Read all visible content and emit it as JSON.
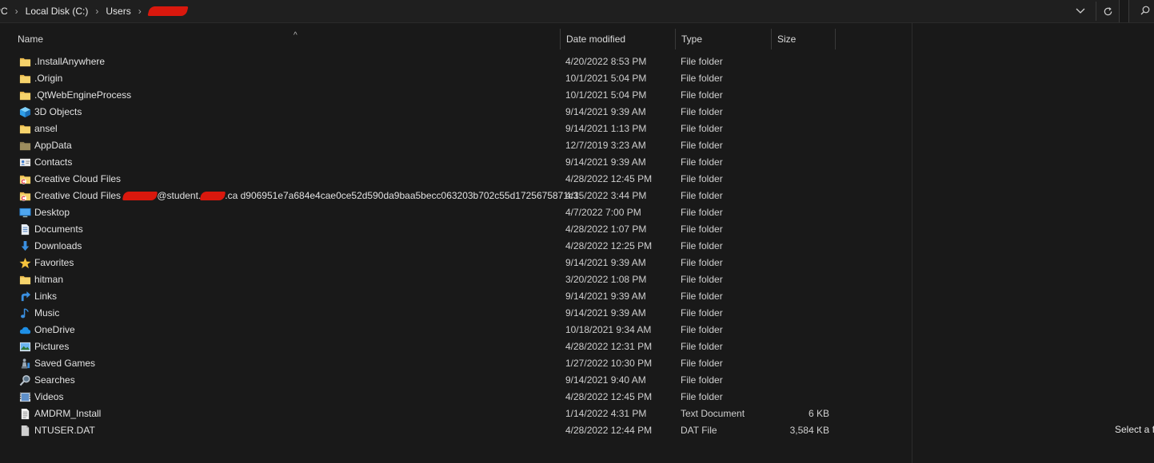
{
  "address": {
    "crumbs": [
      "PC",
      "Local Disk (C:)",
      "Users"
    ],
    "dropdown_icon": "chevron-down-icon",
    "refresh_icon": "refresh-icon",
    "search_icon": "search-icon"
  },
  "columns": {
    "name": "Name",
    "date": "Date modified",
    "type": "Type",
    "size": "Size"
  },
  "files": [
    {
      "name": ".InstallAnywhere",
      "date": "4/20/2022 8:53 PM",
      "type": "File folder",
      "size": "",
      "icon": "folder"
    },
    {
      "name": ".Origin",
      "date": "10/1/2021 5:04 PM",
      "type": "File folder",
      "size": "",
      "icon": "folder"
    },
    {
      "name": ".QtWebEngineProcess",
      "date": "10/1/2021 5:04 PM",
      "type": "File folder",
      "size": "",
      "icon": "folder"
    },
    {
      "name": "3D Objects",
      "date": "9/14/2021 9:39 AM",
      "type": "File folder",
      "size": "",
      "icon": "cube"
    },
    {
      "name": "ansel",
      "date": "9/14/2021 1:13 PM",
      "type": "File folder",
      "size": "",
      "icon": "folder"
    },
    {
      "name": "AppData",
      "date": "12/7/2019 3:23 AM",
      "type": "File folder",
      "size": "",
      "icon": "folder-hidden"
    },
    {
      "name": "Contacts",
      "date": "9/14/2021 9:39 AM",
      "type": "File folder",
      "size": "",
      "icon": "contacts"
    },
    {
      "name": "Creative Cloud Files",
      "date": "4/28/2022 12:45 PM",
      "type": "File folder",
      "size": "",
      "icon": "cc-folder"
    },
    {
      "name_prefix": "Creative Cloud Files ",
      "name_mid": "@student.",
      "name_suffix": ".ca d906951e7a684e4cae0ce52d590da9baa5becc063203b702c55d1725675871c3",
      "date": "4/15/2022 3:44 PM",
      "type": "File folder",
      "size": "",
      "icon": "cc-folder"
    },
    {
      "name": "Desktop",
      "date": "4/7/2022 7:00 PM",
      "type": "File folder",
      "size": "",
      "icon": "desktop"
    },
    {
      "name": "Documents",
      "date": "4/28/2022 1:07 PM",
      "type": "File folder",
      "size": "",
      "icon": "documents"
    },
    {
      "name": "Downloads",
      "date": "4/28/2022 12:25 PM",
      "type": "File folder",
      "size": "",
      "icon": "downloads"
    },
    {
      "name": "Favorites",
      "date": "9/14/2021 9:39 AM",
      "type": "File folder",
      "size": "",
      "icon": "star"
    },
    {
      "name": "hitman",
      "date": "3/20/2022 1:08 PM",
      "type": "File folder",
      "size": "",
      "icon": "folder"
    },
    {
      "name": "Links",
      "date": "9/14/2021 9:39 AM",
      "type": "File folder",
      "size": "",
      "icon": "links"
    },
    {
      "name": "Music",
      "date": "9/14/2021 9:39 AM",
      "type": "File folder",
      "size": "",
      "icon": "music"
    },
    {
      "name": "OneDrive",
      "date": "10/18/2021 9:34 AM",
      "type": "File folder",
      "size": "",
      "icon": "cloud"
    },
    {
      "name": "Pictures",
      "date": "4/28/2022 12:31 PM",
      "type": "File folder",
      "size": "",
      "icon": "pictures"
    },
    {
      "name": "Saved Games",
      "date": "1/27/2022 10:30 PM",
      "type": "File folder",
      "size": "",
      "icon": "chess"
    },
    {
      "name": "Searches",
      "date": "9/14/2021 9:40 AM",
      "type": "File folder",
      "size": "",
      "icon": "search"
    },
    {
      "name": "Videos",
      "date": "4/28/2022 12:45 PM",
      "type": "File folder",
      "size": "",
      "icon": "videos"
    },
    {
      "name": "AMDRM_Install",
      "date": "1/14/2022 4:31 PM",
      "type": "Text Document",
      "size": "6 KB",
      "icon": "text-file"
    },
    {
      "name": "NTUSER.DAT",
      "date": "4/28/2022 12:44 PM",
      "type": "DAT File",
      "size": "3,584 KB",
      "icon": "dat-file"
    }
  ],
  "preview": {
    "message": "Select a fi"
  },
  "colors": {
    "background": "#191919",
    "redaction": "#d9180d",
    "folder": "#f0c956"
  }
}
